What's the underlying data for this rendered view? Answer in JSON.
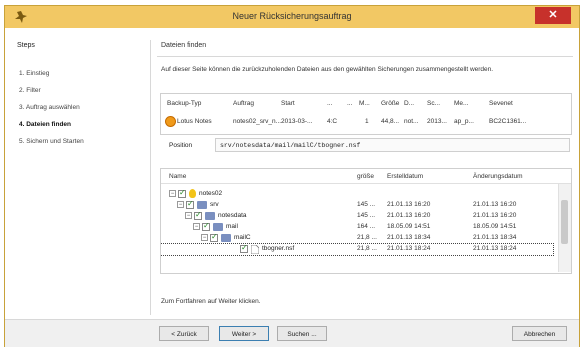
{
  "window": {
    "title": "Neuer Rücksicherungsauftrag",
    "close_label": "✕"
  },
  "steps": {
    "title": "Steps",
    "items": [
      {
        "label": "1. Einstieg",
        "active": false
      },
      {
        "label": "2. Filter",
        "active": false
      },
      {
        "label": "3. Auftrag auswählen",
        "active": false
      },
      {
        "label": "4. Dateien finden",
        "active": true
      },
      {
        "label": "5. Sichern und Starten",
        "active": false
      }
    ]
  },
  "main": {
    "title": "Dateien finden",
    "description": "Auf dieser Seite können die zurückzuholenden Dateien aus den gewählten Sicherungen zusammengestellt werden.",
    "table": {
      "headers": [
        "Backup-Typ",
        "Auftrag",
        "Start",
        "...",
        "...",
        "M...",
        "Größe",
        "D...",
        "Sc...",
        "Me...",
        "Sevenet"
      ],
      "row": [
        "Lotus Notes",
        "notes02_srv_n...",
        "2013-03-...",
        "4:C",
        "",
        "1",
        "44,8...",
        "not...",
        "2013...",
        "ap_p...",
        "BC2C1361..."
      ]
    },
    "path": {
      "label": "Position",
      "value": "srv/notesdata/mail/mailC/tbogner.nsf"
    },
    "tree": {
      "columns": [
        "Name",
        "größe",
        "Erstelldatum",
        "Änderungsdatum"
      ],
      "rows": [
        {
          "name": "notes02",
          "size": "",
          "created": "",
          "changed": ""
        },
        {
          "name": "srv",
          "size": "145 ...",
          "created": "21.01.13 16:20",
          "changed": "21.01.13 16:20"
        },
        {
          "name": "notesdata",
          "size": "145 ...",
          "created": "21.01.13 16:20",
          "changed": "21.01.13 16:20"
        },
        {
          "name": "mail",
          "size": "164 ...",
          "created": "18.05.09 14:51",
          "changed": "18.05.09 14:51"
        },
        {
          "name": "mailC",
          "size": "21,8 ...",
          "created": "21.01.13 18:34",
          "changed": "21.01.13 18:34"
        },
        {
          "name": "tbogner.nsf",
          "size": "21,8 ...",
          "created": "21.01.13 18:24",
          "changed": "21.01.13 18:24"
        }
      ]
    },
    "hint": "Zum Fortfahren auf Weiter klicken."
  },
  "footer": {
    "back_label": "< Zurück",
    "next_label": "Weiter >",
    "search_label": "Suchen ...",
    "cancel_label": "Abbrechen"
  },
  "colors": {
    "titlebar": "#f2c864",
    "close": "#c7312b",
    "status_dot": "#f09a1a"
  }
}
